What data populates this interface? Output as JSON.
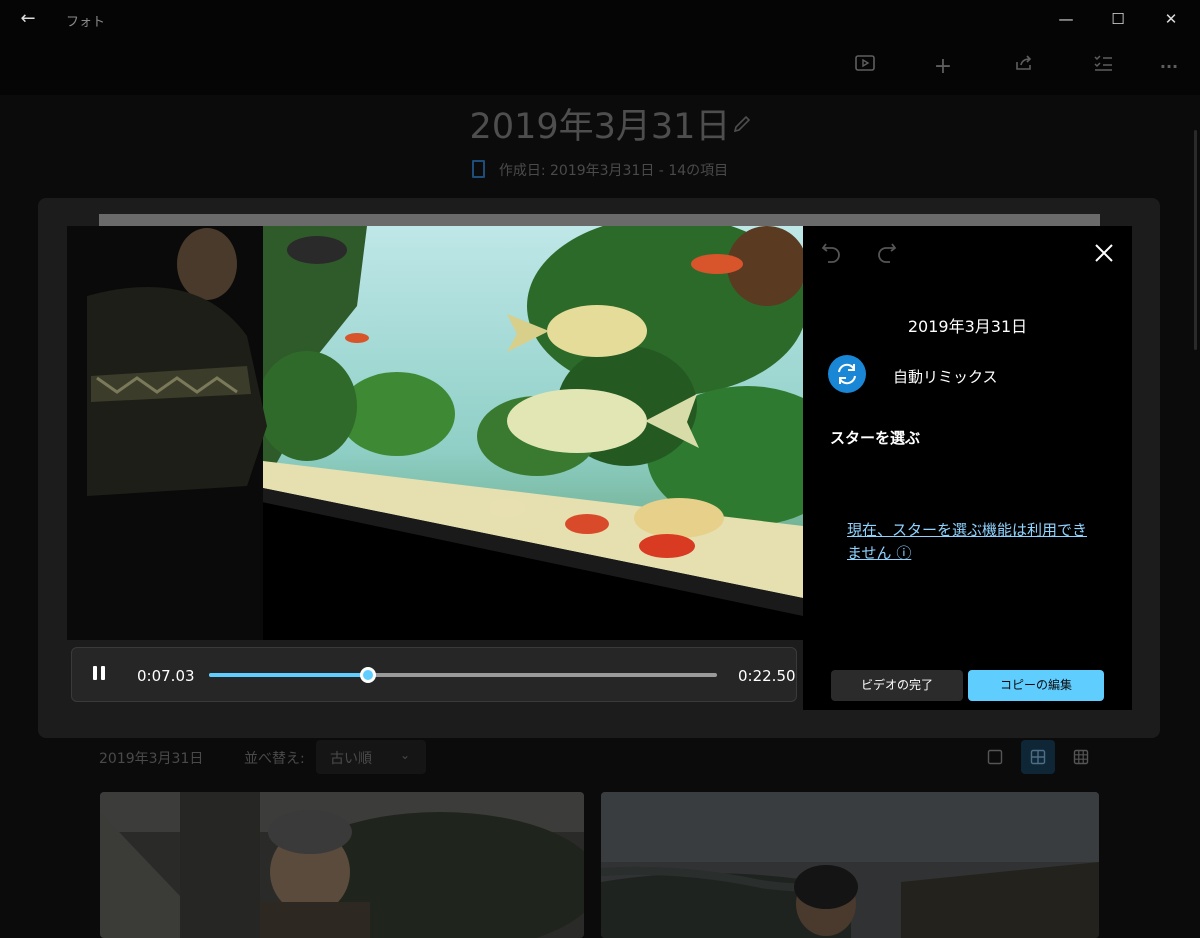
{
  "window": {
    "app_title": "フォト",
    "back_glyph": "←",
    "minimize_glyph": "—",
    "maximize_glyph": "☐",
    "close_glyph": "✕"
  },
  "toolbar": {
    "icons": [
      "slideshow-icon",
      "add-icon",
      "share-icon",
      "select-icon",
      "more-icon"
    ],
    "more_glyph": "···",
    "add_glyph": "+"
  },
  "album": {
    "title": "2019年3月31日",
    "meta": "作成日: 2019年3月31日  -  14の項目"
  },
  "player": {
    "current_time": "0:07.03",
    "total_time": "0:22.50",
    "progress": 0.3125
  },
  "panel": {
    "date": "2019年3月31日",
    "remix_label": "自動リミックス",
    "star_heading": "スターを選ぶ",
    "star_unavailable": "現在、スターを選ぶ機能は利用できません ⓘ",
    "finish_button": "ビデオの完了",
    "edit_copy_button": "コピーの編集"
  },
  "gallery": {
    "date": "2019年3月31日",
    "sort_label": "並べ替え:",
    "sort_value": "古い順"
  },
  "colors": {
    "accent": "#60cdff",
    "remix_blue": "#1a87d6"
  }
}
